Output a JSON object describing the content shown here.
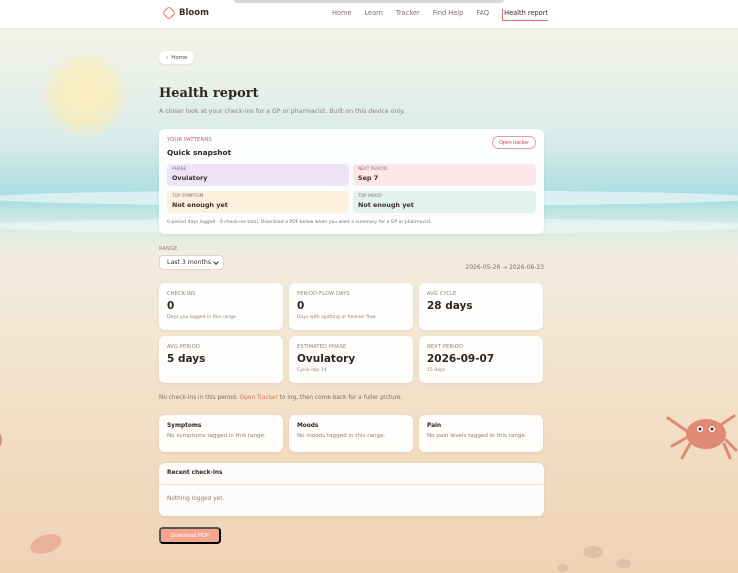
{
  "brand": {
    "name": "Bloom",
    "icon": "flower-icon",
    "accent": "#e2735e"
  },
  "nav": [
    {
      "label": "Home",
      "active": false
    },
    {
      "label": "Learn",
      "active": false
    },
    {
      "label": "Tracker",
      "active": false
    },
    {
      "label": "Find Help",
      "active": false
    },
    {
      "label": "FAQ",
      "active": false
    },
    {
      "label": "Health report",
      "active": true
    }
  ],
  "breadcrumb": {
    "label": "Home",
    "icon": "chevron-left-icon"
  },
  "page": {
    "title": "Health report",
    "subtitle": "A closer look at your check-ins for a GP or pharmacist. Built on this device only."
  },
  "snapshot": {
    "kicker": "YOUR PATTERNS",
    "title": "Quick snapshot",
    "open_tracker": "Open tracker",
    "tiles": {
      "phase": {
        "label": "Phase",
        "value": "Ovulatory"
      },
      "next_period": {
        "label": "Next period",
        "value": "Sep 7"
      },
      "top_symptom": {
        "label": "Top symptom",
        "value": "Not enough yet"
      },
      "top_mood": {
        "label": "Top mood",
        "value": "Not enough yet"
      }
    },
    "footnote": "0 period days logged · 0 check-ins total. Download a PDF below when you want a summary for a GP or pharmacist."
  },
  "range": {
    "label": "RANGE",
    "selected": "Last 3 months",
    "dates": "2026-05-26 → 2026-08-23"
  },
  "stats": [
    {
      "label": "Check-ins",
      "value": "0",
      "note": "Days you logged in this range"
    },
    {
      "label": "Period-flow days",
      "value": "0",
      "note": "Days with spotting or heavier flow"
    },
    {
      "label": "Avg cycle",
      "value": "28 days",
      "note": ""
    },
    {
      "label": "Avg period",
      "value": "5 days",
      "note": ""
    },
    {
      "label": "Estimated phase",
      "value": "Ovulatory",
      "note": "Cycle day 14"
    },
    {
      "label": "Next period",
      "value": "2026-09-07",
      "note": "15 days"
    }
  ],
  "notice": {
    "before": "No check-ins in this period.",
    "link": "Open Tracker",
    "after": "to log, then come back for a fuller picture."
  },
  "mini": [
    {
      "title": "Symptoms",
      "text": "No symptoms tagged in this range."
    },
    {
      "title": "Moods",
      "text": "No moods tagged in this range."
    },
    {
      "title": "Pain",
      "text": "No pain levels tagged in this range."
    }
  ],
  "recent": {
    "title": "Recent check-ins",
    "empty": "Nothing logged yet."
  },
  "download_pdf": "Download PDF"
}
